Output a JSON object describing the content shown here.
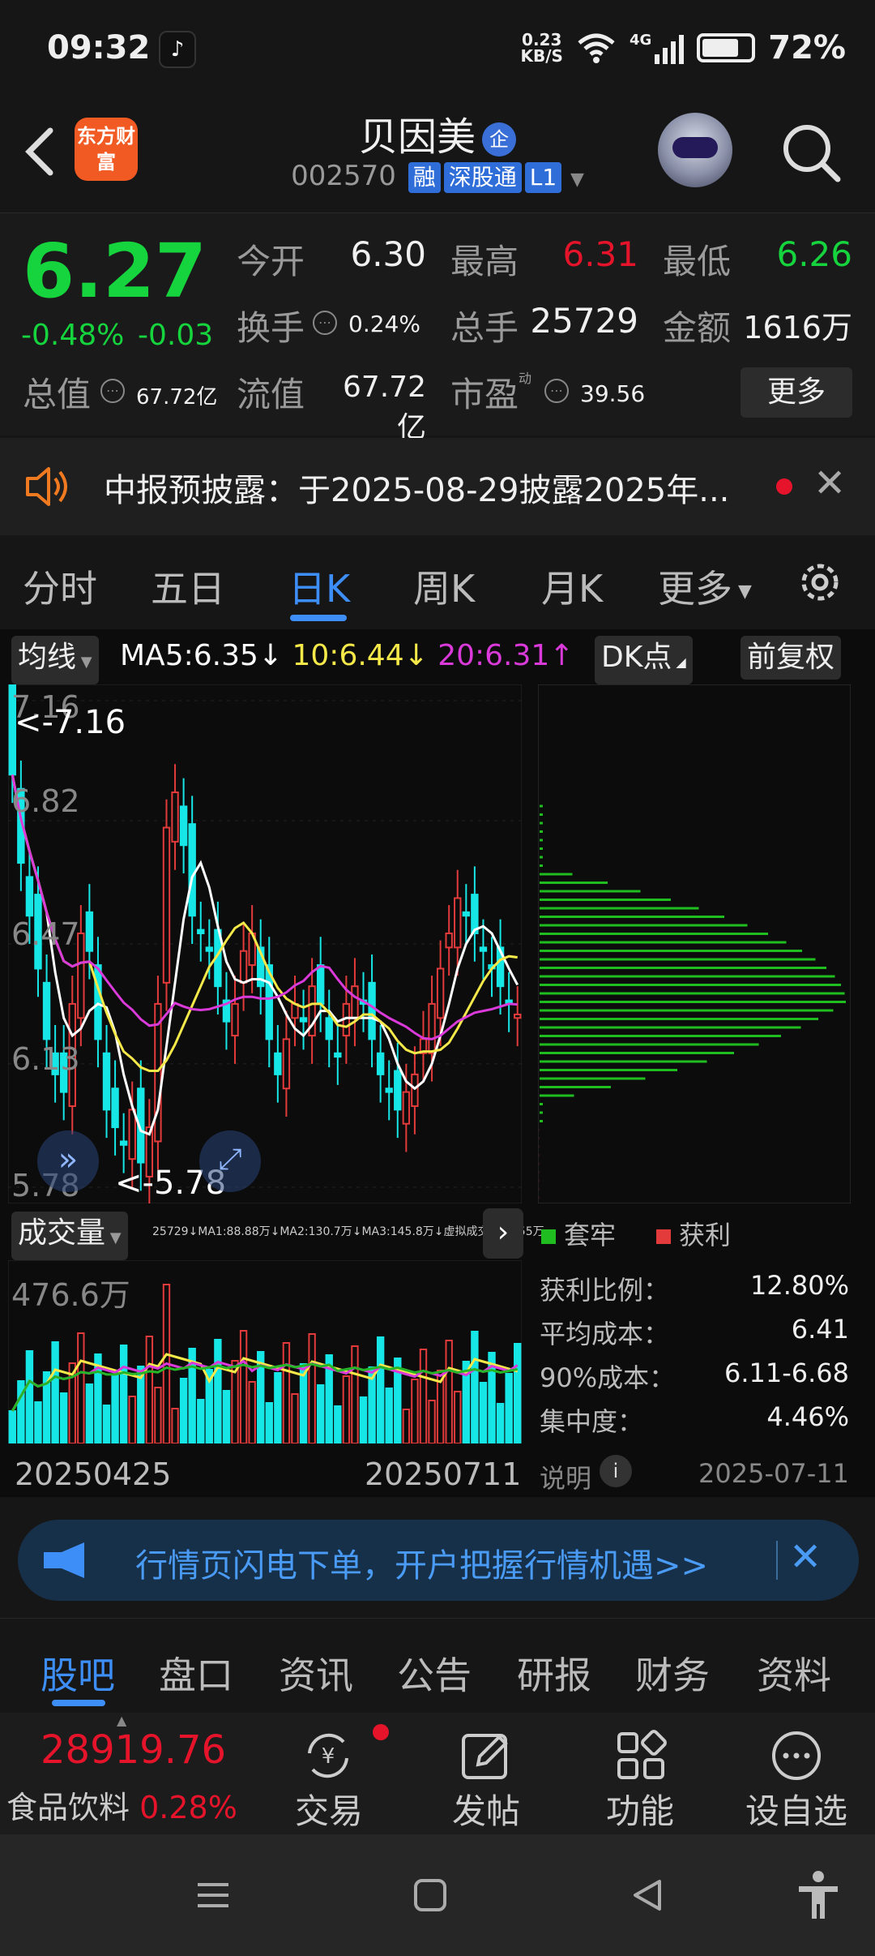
{
  "status": {
    "time": "09:32",
    "net_speed_value": "0.23",
    "net_speed_unit": "KB/S",
    "signal": "4G",
    "battery": "72%"
  },
  "header": {
    "app_logo_text": "东方财富",
    "stock_name": "贝因美",
    "badge": "企",
    "code": "002570",
    "tags": [
      "融",
      "深股通",
      "L1"
    ]
  },
  "quote": {
    "price": "6.27",
    "change_pct": "-0.48%",
    "change": "-0.03",
    "open_label": "今开",
    "open": "6.30",
    "high_label": "最高",
    "high": "6.31",
    "low_label": "最低",
    "low": "6.26",
    "turnover_label": "换手",
    "turnover": "0.24%",
    "volume_label": "总手",
    "volume": "25729",
    "amount_label": "金额",
    "amount": "1616万",
    "mktcap_label": "总值",
    "mktcap": "67.72亿",
    "float_label": "流值",
    "float": "67.72亿",
    "pe_label": "市盈",
    "pe_sup": "动",
    "pe": "39.56",
    "more_label": "更多"
  },
  "notice": {
    "text": "中报预披露：于2025-08-29披露2025年..."
  },
  "chart_tabs": [
    "分时",
    "五日",
    "日K",
    "周K",
    "月K",
    "更多"
  ],
  "chart_tab_active": "日K",
  "kline": {
    "ma_select": "均线",
    "ma5": "MA5:6.35",
    "ma10": "10:6.44",
    "ma20": "20:6.31",
    "dk_label": "DK点",
    "adjust_label": "前复权",
    "y_ticks": [
      "7.16",
      "6.82",
      "6.47",
      "6.13",
      "5.78"
    ],
    "high_marker": "<-7.16",
    "low_marker": "<-5.78",
    "volume_select": "成交量",
    "volume_legend": "25729↓MA1:88.88万↓MA2:130.7万↓MA3:145.8万↓虚拟成交量92.55万",
    "volume_max": "476.6万",
    "date_start": "20250425",
    "date_end": "20250711",
    "colors": {
      "up": "#e33b3b",
      "down": "#17e6e6",
      "ma5": "#ffffff",
      "ma10": "#f5e94a",
      "ma20": "#d93ad9",
      "ma_vol3": "#26b526"
    }
  },
  "chip": {
    "legend_trapped": "套牢",
    "legend_profit": "获利",
    "rows": [
      {
        "label": "获利比例：",
        "value": "12.80%"
      },
      {
        "label": "平均成本：",
        "value": "6.41"
      },
      {
        "label": "90%成本：",
        "value": "6.11-6.68"
      },
      {
        "label": "集中度：",
        "value": "4.46%"
      }
    ],
    "note_label": "说明",
    "date": "2025-07-11"
  },
  "banner": {
    "text": "行情页闪电下单，开户把握行情机遇>>"
  },
  "bottom_tabs": [
    "股吧",
    "盘口",
    "资讯",
    "公告",
    "研报",
    "财务",
    "资料"
  ],
  "bottom_tab_active": "股吧",
  "toolbar": {
    "index_value": "28919.76",
    "sector_name": "食品饮料",
    "sector_change": "0.28%",
    "items": [
      "交易",
      "发帖",
      "功能",
      "设自选"
    ]
  }
}
